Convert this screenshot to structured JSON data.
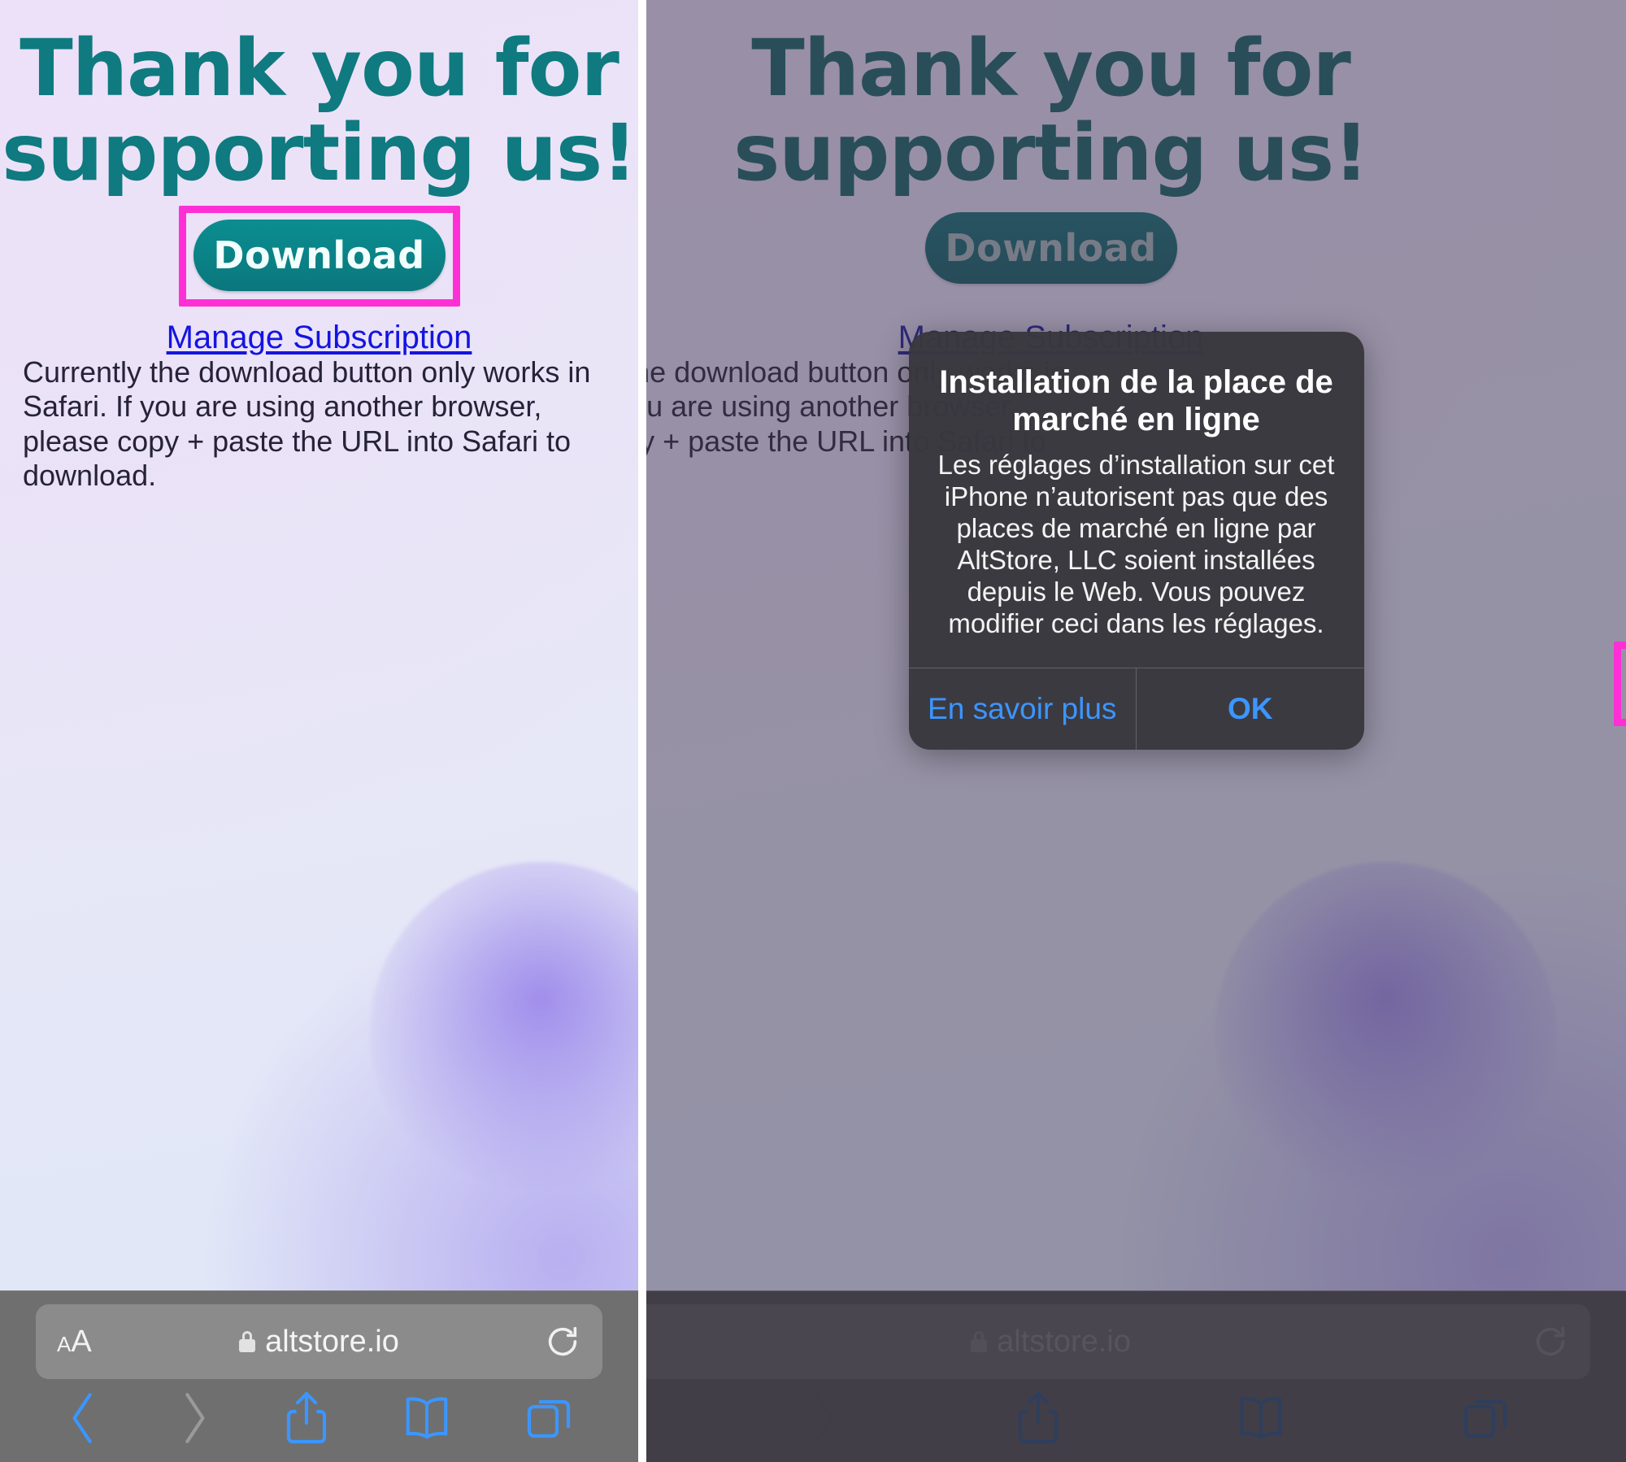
{
  "page": {
    "headline_line1": "Thank you for",
    "headline_line2": "supporting us!",
    "download_label": "Download",
    "manage_subscription_label": "Manage Subscription",
    "paragraph": "Currently the download button only works in Safari. If you are using another browser, please copy + paste the URL into Safari to download.",
    "accent_teal": "#0f7a7f",
    "link_blue": "#1414e0",
    "highlight_pink": "#ff2fd6"
  },
  "browser": {
    "aa_small": "A",
    "aa_large": "A",
    "url": "altstore.io",
    "lock_icon": "lock-icon",
    "reload_icon": "reload-icon",
    "back_icon": "chevron-left-icon",
    "forward_icon": "chevron-right-icon",
    "share_icon": "share-icon",
    "bookmarks_icon": "book-icon",
    "tabs_icon": "tabs-icon"
  },
  "alert": {
    "title": "Installation de la place de marché en ligne",
    "message": "Les réglages d’installation sur cet iPhone n’autorisent pas que des places de marché en ligne par AltStore, LLC soient installées depuis le Web. Vous pouvez modifier ceci dans les réglages.",
    "learn_more_label": "En savoir plus",
    "ok_label": "OK",
    "button_blue": "#3b96ff"
  }
}
